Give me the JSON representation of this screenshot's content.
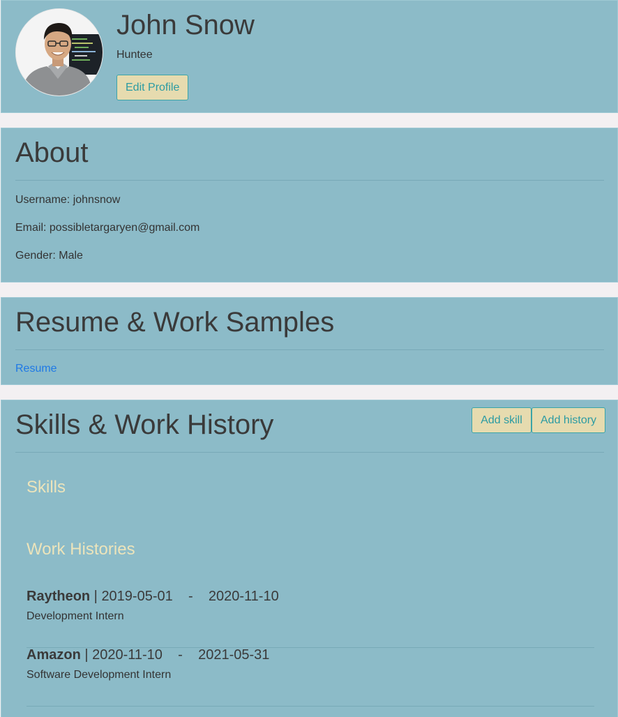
{
  "profile": {
    "name": "John Snow",
    "role": "Huntee",
    "edit_button": "Edit Profile"
  },
  "about": {
    "title": "About",
    "username": "Username: johnsnow",
    "email": "Email: possibletargaryen@gmail.com",
    "gender": "Gender: Male"
  },
  "resume": {
    "title": "Resume & Work Samples",
    "link": "Resume"
  },
  "skills_section": {
    "title": "Skills & Work History",
    "add_skill_button": "Add skill",
    "add_history_button": "Add history",
    "skills_heading": "Skills",
    "histories_heading": "Work Histories",
    "histories": [
      {
        "company": "Raytheon",
        "start": "2019-05-01",
        "separator": "-",
        "end": "2020-11-10",
        "title": "Development Intern"
      },
      {
        "company": "Amazon",
        "start": "2020-11-10",
        "separator": "-",
        "end": "2021-05-31",
        "title": "Software Development Intern"
      }
    ]
  },
  "colors": {
    "card_background": "#8cbbc8",
    "page_background": "#f3f0f2",
    "button_background": "#e6dbaf",
    "button_text": "#2b9ba3",
    "subheading": "#ece4bb",
    "link": "#1f79e6"
  }
}
